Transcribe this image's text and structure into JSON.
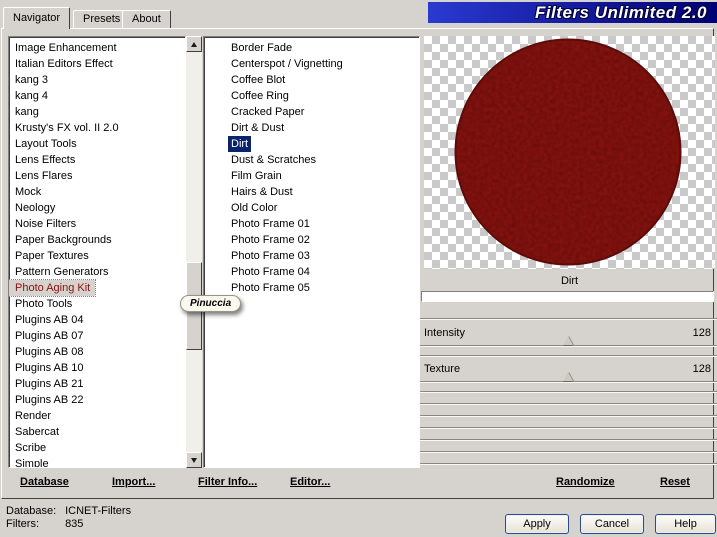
{
  "window": {
    "title": "Filters Unlimited 2.0"
  },
  "tabs": [
    {
      "label": "Navigator"
    },
    {
      "label": "Presets"
    },
    {
      "label": "About"
    }
  ],
  "categories": {
    "selected": "Photo Aging Kit",
    "items": [
      "Image Enhancement",
      "Italian Editors Effect",
      "kang 3",
      "kang 4",
      "kang",
      "Krusty's FX vol. II 2.0",
      "Layout Tools",
      "Lens Effects",
      "Lens Flares",
      "Mock",
      "Neology",
      "Noise Filters",
      "Paper Backgrounds",
      "Paper Textures",
      "Pattern Generators",
      "Photo Aging Kit",
      "Photo Tools",
      "Plugins AB 04",
      "Plugins AB 07",
      "Plugins AB 08",
      "Plugins AB 10",
      "Plugins AB 21",
      "Plugins AB 22",
      "Render",
      "Sabercat",
      "Scribe",
      "Simple"
    ]
  },
  "filters": {
    "selected": "Dirt",
    "items": [
      "Border Fade",
      "Centerspot / Vignetting",
      "Coffee Blot",
      "Coffee Ring",
      "Cracked Paper",
      "Dirt & Dust",
      "Dirt",
      "Dust & Scratches",
      "Film Grain",
      "Hairs & Dust",
      "Old Color",
      "Photo Frame 01",
      "Photo Frame 02",
      "Photo Frame 03",
      "Photo Frame 04",
      "Photo Frame 05"
    ]
  },
  "watermark": "Pinuccia",
  "preview": {
    "caption": "Dirt"
  },
  "sliders": [
    {
      "name": "Intensity",
      "value": "128"
    },
    {
      "name": "Texture",
      "value": "128"
    }
  ],
  "commands": {
    "database": "Database",
    "import": "Import...",
    "filter_info": "Filter Info...",
    "editor": "Editor...",
    "randomize": "Randomize",
    "reset": "Reset"
  },
  "status": {
    "database_label": "Database:",
    "database_value": "ICNET-Filters",
    "filters_label": "Filters:",
    "filters_value": "835"
  },
  "footer_buttons": {
    "apply": "Apply",
    "cancel": "Cancel",
    "help": "Help"
  },
  "colors": {
    "selection": "#0a246a",
    "title_gradient_start": "#2a3ad0",
    "title_gradient_end": "#000072",
    "circle": "#911712"
  }
}
